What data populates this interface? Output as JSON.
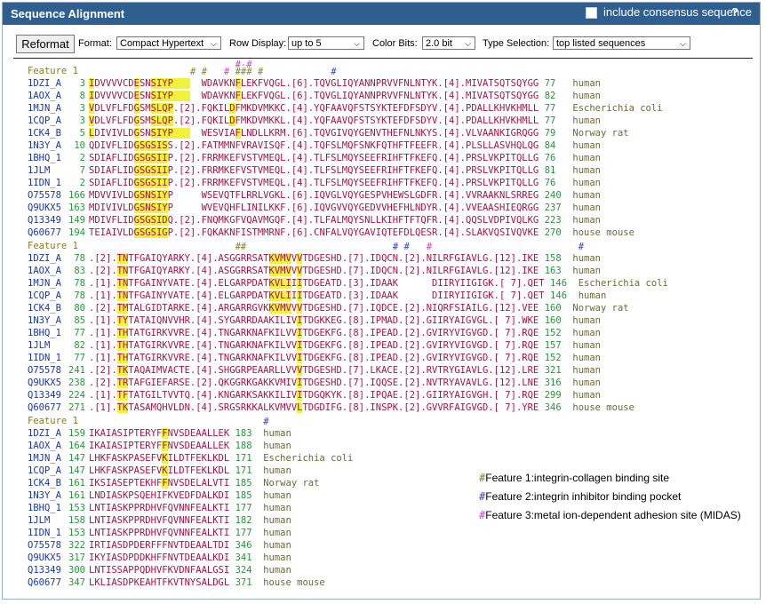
{
  "header": {
    "title": "Sequence Alignment",
    "consensus_label": "include consensus sequence",
    "help": "?"
  },
  "controls": {
    "reformat_label": "Reformat",
    "format_label": "Format:",
    "format_value": "Compact Hypertext",
    "row_display_label": "Row Display:",
    "row_display_value": "up to 5",
    "color_bits_label": "Color Bits:",
    "color_bits_value": "2.0 bit",
    "type_selection_label": "Type Selection:",
    "type_selection_value": "top listed sequences"
  },
  "blocks": [
    {
      "feature_label": "Feature 1",
      "markers": [
        {
          "col": 18,
          "ch": "#",
          "type": 1
        },
        {
          "col": 20,
          "ch": "#",
          "type": 1
        },
        {
          "col": 24,
          "ch": "#",
          "type": 3
        },
        {
          "col": 26,
          "ch": "###",
          "type": 1
        },
        {
          "col": 30,
          "ch": "#",
          "type": 1
        },
        {
          "col": 43,
          "ch": "#",
          "type": 2
        }
      ],
      "markers_top": [
        {
          "col": 26,
          "ch": "#",
          "type": 3
        },
        {
          "col": 27,
          "ch": "-",
          "type": 3
        },
        {
          "col": 28,
          "ch": "#",
          "type": 3
        }
      ],
      "rows": [
        {
          "acc": "1DZI_A",
          "start": "3",
          "seq": "IDVVVVCDESNSIYP     WDAVKNFLEKFVQGL.[6].TQVGLIQYANNPRVVFNLNTYK.[4].MIVATSQTSQYGG",
          "end": "77",
          "org": "human",
          "hi": [
            0,
            8,
            11,
            12,
            13,
            14,
            15,
            16,
            17,
            26
          ]
        },
        {
          "acc": "1AOX_A",
          "start": "8",
          "seq": "IDVVVVCDESNSIYP     WDAVKNFLEKFVQGL.[6].TQVGLIQYANNPRVVFNLNTYK.[4].MIVATSQTSQYGG",
          "end": "82",
          "org": "human",
          "hi": [
            0,
            8,
            11,
            12,
            13,
            14,
            15,
            16,
            17,
            26
          ]
        },
        {
          "acc": "1MJN_A",
          "start": "3",
          "seq": "VDLVFLFDGSMSLQP.[2].FQKILDFMKDVMKKC.[4].YQFAAVQFSTSYKTEFDFSDYV.[4].PDALLKHVKHMLL",
          "end": "77",
          "org": "Escherichia coli",
          "hi": [
            0,
            8,
            11,
            12,
            13,
            14,
            25
          ]
        },
        {
          "acc": "1CQP_A",
          "start": "3",
          "seq": "VDLVFLFDGSMSLQP.[2].FQKILDFMKDVMKKL.[4].YQFAAVQFSTSYKTEFDFSDYV.[4].PDALLKHVKHMLL",
          "end": "77",
          "org": "human",
          "hi": [
            0,
            8,
            11,
            12,
            13,
            14,
            25
          ]
        },
        {
          "acc": "1CK4_B",
          "start": "5",
          "seq": "LDIVIVLDGSNSIYP     WESVIAFLNDLLKRM.[6].TQVGIVQYGENVTHEFNLNKYS.[4].VLVAANKIGRQGG",
          "end": "79",
          "org": "Norway rat",
          "hi": [
            0,
            8,
            11,
            12,
            13,
            14,
            15,
            16,
            17,
            26
          ]
        },
        {
          "acc": "1N3Y_A",
          "start": "10",
          "seq": "QDIVFLIDGSGSISS.[2].FATMMNFVRAVISQF.[4].TQFSLMQFSNKFQTHFTFEEFR.[4].PLSLLASVHQLQG",
          "end": "84",
          "org": "human",
          "hi": [
            8,
            9,
            10,
            11,
            12,
            13
          ]
        },
        {
          "acc": "1BHQ_1",
          "start": "2",
          "seq": "SDIAFLIDGSGSIIP.[2].FRRMKEFVSTVMEQL.[4].TLFSLMQYSEEFRIHFTFKEFQ.[4].PRSLVKPITQLLG",
          "end": "76",
          "org": "human",
          "hi": [
            8,
            9,
            10,
            11,
            12,
            13
          ]
        },
        {
          "acc": "1JLM",
          "start": "7",
          "seq": "SDIAFLIDGSGSIIP.[2].FRRMKEFVSTVMEQL.[4].TLFSLMQYSEEFRIHFTFKEFQ.[4].PRSLVKPITQLLG",
          "end": "81",
          "org": "human",
          "hi": [
            8,
            9,
            10,
            11,
            12,
            13
          ]
        },
        {
          "acc": "1IDN_1",
          "start": "2",
          "seq": "SDIAFLIDGSGSIIP.[2].FRRMKEFVSTVMEQL.[4].TLFSLMQYSEEFRIHFTFKEFQ.[4].PRSLVKPITQLLG",
          "end": "76",
          "org": "human",
          "hi": [
            8,
            9,
            10,
            11,
            12,
            13
          ]
        },
        {
          "acc": "O75578",
          "start": "166",
          "seq": "MDVVIVLDGSNSIYP     WSEVQTFLRRLVGKL.[6].IQVGLVQYGESPVHEWSLGDFR.[4].VVRAAKNLSRREG",
          "end": "240",
          "org": "human",
          "hi": [
            8,
            9,
            10,
            11,
            12,
            13
          ]
        },
        {
          "acc": "Q9UKX5",
          "start": "163",
          "seq": "MDIVIVLDGSNSIYP     WVEVQHFLINILKKF.[6].IQVGVVQYGEDVVHEFHLNDYR.[4].VVEAASHIEQRGG",
          "end": "237",
          "org": "human",
          "hi": [
            8,
            9,
            10,
            11,
            12,
            13
          ]
        },
        {
          "acc": "Q13349",
          "start": "149",
          "seq": "MDIVFLIDGSGSIDQ.[2].FNQMKGFVQAVMGQF.[4].TLFALMQYSNLLKIHFTFTQFR.[4].QQSLVDPIVQLKG",
          "end": "223",
          "org": "human",
          "hi": [
            8,
            9,
            10,
            11,
            12,
            13
          ]
        },
        {
          "acc": "Q60677",
          "start": "194",
          "seq": "TEIAIVLDGSGSIGP.[2].FQKAKNFISTMMRNF.[6].CNFALVQYGAVIQTEFDLQESR.[4].SLAKVQSIVQVKE",
          "end": "270",
          "org": "house mouse",
          "hi": [
            8,
            9,
            10,
            11,
            12,
            13
          ]
        }
      ]
    },
    {
      "feature_label": "Feature 1",
      "markers": [
        {
          "col": 26,
          "ch": "##",
          "type": 1
        },
        {
          "col": 54,
          "ch": "#",
          "type": 2
        },
        {
          "col": 56,
          "ch": "#",
          "type": 2
        },
        {
          "col": 60,
          "ch": "#",
          "type": 3
        },
        {
          "col": 87,
          "ch": "#",
          "type": 2
        }
      ],
      "markers_top": [],
      "rows": [
        {
          "acc": "1DZI_A",
          "start": "78",
          "seq": ".[2].TNTFGAIQYARKY.[4].ASGGRRSATKVMVVVTDGESHD.[7].IDQCN.[2].NILRFGIAVLG.[12].IKE",
          "end": "158",
          "org": "human",
          "hi": [
            5,
            6,
            32,
            33,
            34,
            35,
            37
          ]
        },
        {
          "acc": "1AOX_A",
          "start": "83",
          "seq": ".[2].TNTFGAIQYARKY.[4].ASGGRRSATKVMVVVTDGESHD.[7].IDQCN.[2].NILRFGIAVLG.[12].IKE",
          "end": "163",
          "org": "human",
          "hi": [
            5,
            6,
            32,
            33,
            34,
            35,
            37
          ]
        },
        {
          "acc": "1MJN_A",
          "start": "78",
          "seq": ".[1].TNTFGAINYVATE.[4].ELGARPDATKVLIIITDGEATD.[3].IDAAK      DIIRYIIGIGK.[ 7].QET",
          "end": "146",
          "org": "Escherichia coli",
          "hi": [
            5,
            6,
            32,
            33,
            34,
            35,
            37
          ]
        },
        {
          "acc": "1CQP_A",
          "start": "78",
          "seq": ".[1].TNTFGAINYVATE.[4].ELGARPDATKVLIIITDGEATD.[3].IDAAK      DIIRYIIGIGK.[ 7].QET",
          "end": "146",
          "org": "human",
          "hi": [
            5,
            6,
            32,
            33,
            34,
            35,
            37
          ]
        },
        {
          "acc": "1CK4_B",
          "start": "80",
          "seq": ".[2].TMTALGIDTARKE.[4].ARGARRGVKKVMVVVTDGESHD.[7].IQDCE.[2].NIQRFSIAILG.[12].VEE",
          "end": "160",
          "org": "Norway rat",
          "hi": [
            5,
            6,
            32,
            33,
            34,
            35,
            37
          ]
        },
        {
          "acc": "1N3Y_A",
          "start": "85",
          "seq": ".[1].TYTATAIQNVVHR.[4].SYGARRDAAKILIVITDGKKEG.[8].IPMAD.[2].GIIRYAIGVGL.[ 7].WKE",
          "end": "160",
          "org": "human",
          "hi": [
            5,
            6,
            37
          ]
        },
        {
          "acc": "1BHQ_1",
          "start": "77",
          "seq": ".[1].THTATGIRKVVRE.[4].TNGARKNAFKILVVITDGEKFG.[8].IPEAD.[2].GVIRYVIGVGD.[ 7].RQE",
          "end": "152",
          "org": "human",
          "hi": [
            5,
            6,
            37
          ]
        },
        {
          "acc": "1JLM",
          "start": "82",
          "seq": ".[1].THTATGIRKVVRE.[4].TNGARKNAFKILVVITDGEKFG.[8].IPEAD.[2].GVIRYVIGVGD.[ 7].RQE",
          "end": "157",
          "org": "human",
          "hi": [
            5,
            6,
            37
          ]
        },
        {
          "acc": "1IDN_1",
          "start": "77",
          "seq": ".[1].THTATGIRKVVRE.[4].TNGARKNAFKILVVITDGEKFG.[8].IPEAD.[2].GVIRYVIGVGD.[ 7].RQE",
          "end": "152",
          "org": "human",
          "hi": [
            5,
            6,
            37
          ]
        },
        {
          "acc": "O75578",
          "start": "241",
          "seq": ".[2].TKTAQAIMVACTE.[4].SHGGRPEAARLLVVVTDGESHD.[7].LKACE.[2].RVTRYGIAVLG.[12].LRE",
          "end": "321",
          "org": "human",
          "hi": [
            5,
            6,
            37
          ]
        },
        {
          "acc": "Q9UKX5",
          "start": "238",
          "seq": ".[2].TRTAFGIEFARSE.[2].QKGGRKGAKKVMIVITDGESHD.[7].IQQSE.[2].NVTRYAVAVLG.[12].LNE",
          "end": "316",
          "org": "human",
          "hi": [
            5,
            6,
            37
          ]
        },
        {
          "acc": "Q13349",
          "start": "224",
          "seq": ".[1].TFTATGILTVVTQ.[4].KNGARKSAKKILIVITDGQKYK.[8].IPQAE.[2].GIIRYAIGVGH.[ 7].RQE",
          "end": "299",
          "org": "human",
          "hi": [
            5,
            6,
            37
          ]
        },
        {
          "acc": "Q60677",
          "start": "271",
          "seq": ".[1].TKTASAMQHVLDN.[4].SRGSRKKALKVMVVLTDGDIFG.[8].INSPK.[2].GVVRFAIGVGD.[ 7].YRE",
          "end": "346",
          "org": "house mouse",
          "hi": [
            5,
            6,
            37
          ]
        }
      ]
    },
    {
      "feature_label": "Feature 1",
      "markers": [
        {
          "col": 31,
          "ch": "#",
          "type": 2
        }
      ],
      "markers_top": [],
      "rows": [
        {
          "acc": "1DZI_A",
          "start": "159",
          "seq": "IKAIASIPTERYFFNVSDEAALLEK",
          "end": "183",
          "org": "human",
          "hi": [
            13
          ]
        },
        {
          "acc": "1AOX_A",
          "start": "164",
          "seq": "IKAIASIPTERYFFNVSDEAALLEK",
          "end": "188",
          "org": "human",
          "hi": [
            13
          ]
        },
        {
          "acc": "1MJN_A",
          "start": "147",
          "seq": "LHKFASKPASEFVKILDTFEKLKDL",
          "end": "171",
          "org": "Escherichia coli",
          "hi": [
            13
          ]
        },
        {
          "acc": "1CQP_A",
          "start": "147",
          "seq": "LHKFASKPASEFVKILDTFEKLKDL",
          "end": "171",
          "org": "human",
          "hi": [
            13
          ]
        },
        {
          "acc": "1CK4_B",
          "start": "161",
          "seq": "IKSIASEPTEKHFFNVSDELALVTI",
          "end": "185",
          "org": "Norway rat",
          "hi": [
            13
          ]
        },
        {
          "acc": "1N3Y_A",
          "start": "161",
          "seq": "LNDIASKPSQEHIFKVEDFDALKDI",
          "end": "185",
          "org": "human",
          "hi": []
        },
        {
          "acc": "1BHQ_1",
          "start": "153",
          "seq": "LNTIASKPPRDHVFQVNNFEALKTI",
          "end": "177",
          "org": "human",
          "hi": []
        },
        {
          "acc": "1JLM",
          "start": "158",
          "seq": "LNTIASKPPRDHVFQVNNFEALKTI",
          "end": "182",
          "org": "human",
          "hi": []
        },
        {
          "acc": "1IDN_1",
          "start": "153",
          "seq": "LNTIASKPPRDHVFQVNNFEALKTI",
          "end": "177",
          "org": "human",
          "hi": []
        },
        {
          "acc": "O75578",
          "start": "322",
          "seq": "IRTIASDPDERFFFNVTDEAALTDI",
          "end": "346",
          "org": "human",
          "hi": []
        },
        {
          "acc": "Q9UKX5",
          "start": "317",
          "seq": "IKYIASDPDDKHFFNVTDEAALKDI",
          "end": "341",
          "org": "human",
          "hi": []
        },
        {
          "acc": "Q13349",
          "start": "300",
          "seq": "LNTISSAPPQDHVFKVDNFAALGSI",
          "end": "324",
          "org": "human",
          "hi": []
        },
        {
          "acc": "Q60677",
          "start": "347",
          "seq": "LKLIASDPKEAHTFKVTNYSALDGL",
          "end": "371",
          "org": "house mouse",
          "hi": []
        }
      ]
    }
  ],
  "legend": [
    {
      "mark": "#",
      "type": 1,
      "text": "Feature 1:integrin-collagen binding site"
    },
    {
      "mark": "#",
      "type": 2,
      "text": "Feature 2:integrin inhibitor binding pocket"
    },
    {
      "mark": "#",
      "type": 3,
      "text": "Feature 3:metal ion-dependent adhesion site (MIDAS)"
    }
  ],
  "colors": {
    "header_bg": "#2e5f8e",
    "highlight": "#f2f23c",
    "seq": "#a81447",
    "accession": "#1a37a8",
    "position": "#27963a"
  }
}
